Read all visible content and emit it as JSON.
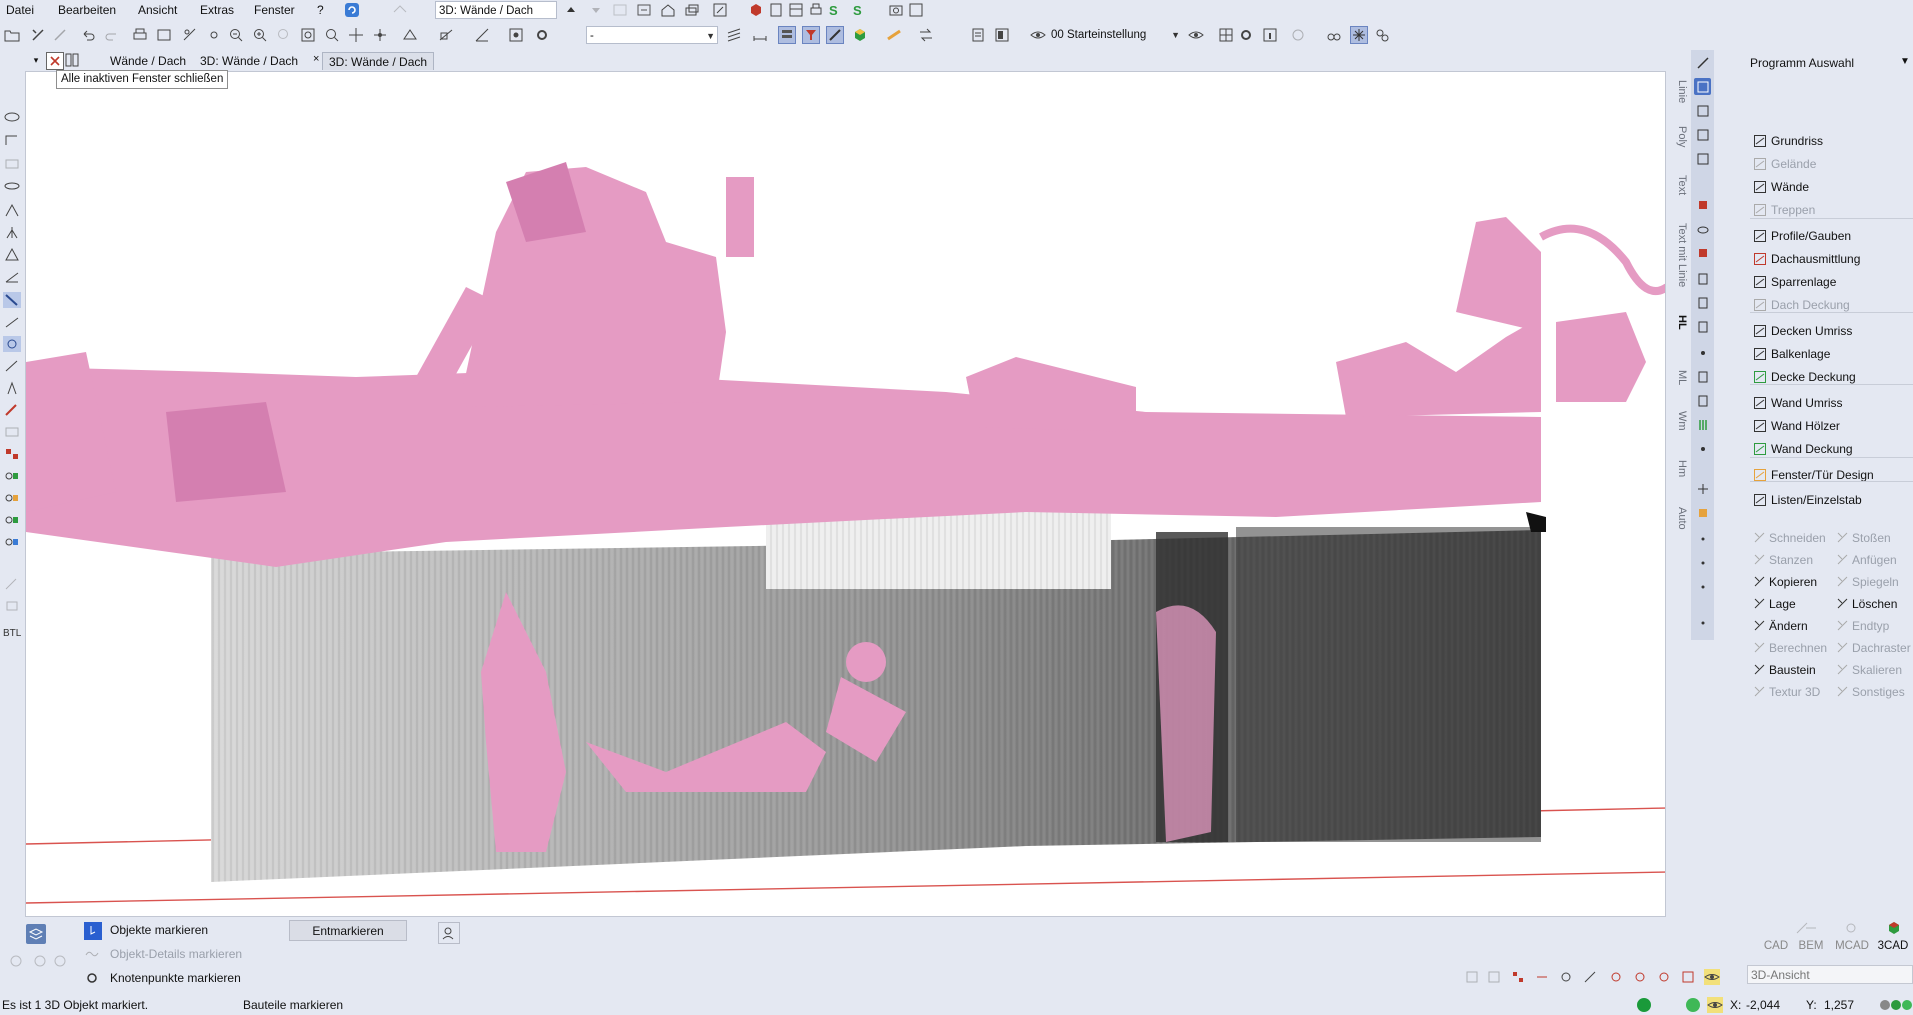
{
  "menu": {
    "items": [
      "Datei",
      "Bearbeiten",
      "Ansicht",
      "Extras",
      "Fenster",
      "?"
    ]
  },
  "toolbar": {
    "view_combo": "3D: Wände / Dach",
    "layer_combo": "-",
    "preset_combo": "00 Starteinstellung"
  },
  "tabs": [
    {
      "label": "Wände / Dach",
      "active": false
    },
    {
      "label": "3D: Wände / Dach",
      "active": false
    },
    {
      "label": "3D: Wände / Dach",
      "active": true
    }
  ],
  "tooltip": "Alle inaktiven Fenster schließen",
  "left_tools": {
    "btl_label": "BTL"
  },
  "vertical_labels": [
    "Linie",
    "Poly",
    "Text",
    "Text mit Linie",
    "HL",
    "ML",
    "Wm",
    "Hm",
    "Auto"
  ],
  "program_panel": {
    "title": "Programm Auswahl",
    "items": [
      {
        "label": "Grundriss",
        "enabled": true,
        "icon": "floorplan-icon"
      },
      {
        "label": "Gelände",
        "enabled": false,
        "icon": "terrain-icon"
      },
      {
        "label": "Wände",
        "enabled": true,
        "icon": "wall-icon"
      },
      {
        "label": "Treppen",
        "enabled": false,
        "icon": "stairs-icon"
      },
      {
        "label": "Profile/Gauben",
        "enabled": true,
        "icon": "profile-icon"
      },
      {
        "label": "Dachausmittlung",
        "enabled": true,
        "icon": "roof-icon"
      },
      {
        "label": "Sparrenlage",
        "enabled": true,
        "icon": "rafter-icon"
      },
      {
        "label": "Dach Deckung",
        "enabled": false,
        "icon": "roof-cover-icon"
      },
      {
        "label": "Decken Umriss",
        "enabled": true,
        "icon": "ceiling-outline-icon"
      },
      {
        "label": "Balkenlage",
        "enabled": true,
        "icon": "beam-layout-icon"
      },
      {
        "label": "Decke Deckung",
        "enabled": true,
        "icon": "ceiling-cover-icon"
      },
      {
        "label": "Wand Umriss",
        "enabled": true,
        "icon": "wall-outline-icon"
      },
      {
        "label": "Wand Hölzer",
        "enabled": true,
        "icon": "wall-timber-icon"
      },
      {
        "label": "Wand Deckung",
        "enabled": true,
        "icon": "wall-cover-icon"
      },
      {
        "label": "Fenster/Tür Design",
        "enabled": true,
        "icon": "window-door-icon"
      },
      {
        "label": "Listen/Einzelstab",
        "enabled": true,
        "icon": "list-icon"
      }
    ]
  },
  "edit_tools": [
    {
      "label": "Schneiden",
      "enabled": false
    },
    {
      "label": "Stoßen",
      "enabled": false
    },
    {
      "label": "Stanzen",
      "enabled": false
    },
    {
      "label": "Anfügen",
      "enabled": false
    },
    {
      "label": "Kopieren",
      "enabled": true
    },
    {
      "label": "Spiegeln",
      "enabled": false
    },
    {
      "label": "Lage",
      "enabled": true
    },
    {
      "label": "Löschen",
      "enabled": true
    },
    {
      "label": "Ändern",
      "enabled": true
    },
    {
      "label": "Endtyp",
      "enabled": false
    },
    {
      "label": "Berechnen",
      "enabled": false
    },
    {
      "label": "Dachraster",
      "enabled": false
    },
    {
      "label": "Baustein",
      "enabled": true
    },
    {
      "label": "Skalieren",
      "enabled": false
    },
    {
      "label": "Textur 3D",
      "enabled": false
    },
    {
      "label": "Sonstiges",
      "enabled": false
    }
  ],
  "selection_panel": {
    "mark_objects": "Objekte markieren",
    "mark_details": "Objekt-Details markieren",
    "mark_nodes": "Knotenpunkte markieren",
    "unmark_button": "Entmarkieren"
  },
  "modes": [
    "CAD",
    "BEM",
    "MCAD",
    "3CAD"
  ],
  "view_selector": "3D-Ansicht",
  "status": {
    "message": "Es ist 1 3D Objekt markiert.",
    "hint": "Bauteile markieren",
    "x_label": "X:",
    "x_value": "-2,044",
    "y_label": "Y:",
    "y_value": "1,257"
  },
  "colors": {
    "accent": "#4a72c4",
    "point_cloud_pink": "#e59bc3",
    "ground_line": "#d9534f",
    "status_green": "#1a9a3a"
  }
}
